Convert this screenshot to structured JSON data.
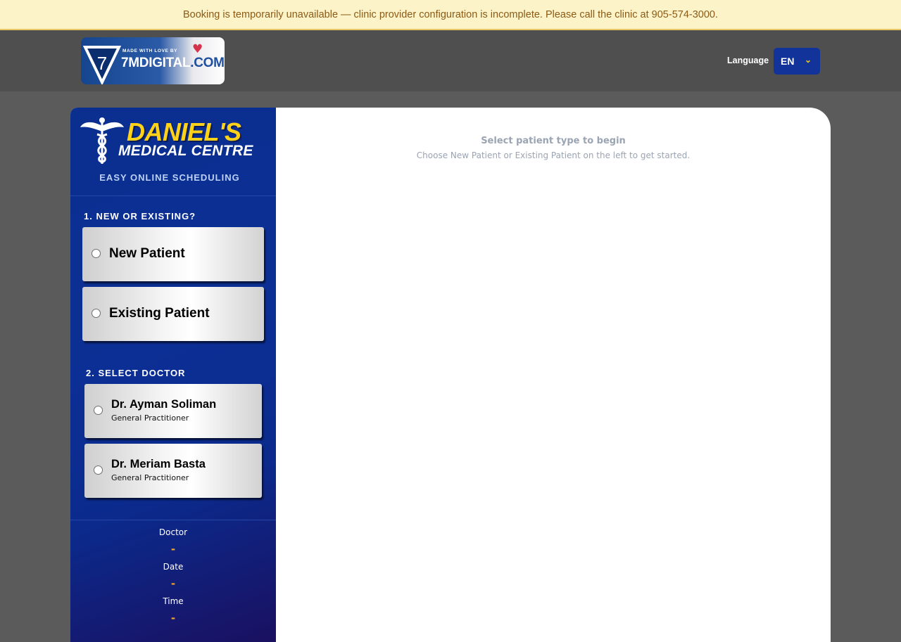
{
  "banner": {
    "text": "Booking is temporarily unavailable — clinic provider configuration is incomplete. Please call the clinic at 905-574-3000."
  },
  "brand": {
    "made_with": "MADE WITH LOVE BY",
    "name_main": "7MDIGITAL",
    "name_suffix": ".COM",
    "badge_number": "7"
  },
  "language": {
    "label": "Language",
    "selected": "EN"
  },
  "clinic": {
    "name_line1": "DANIEL'S",
    "name_line2": "MEDICAL CENTRE",
    "tagline": "EASY ONLINE SCHEDULING"
  },
  "steps": {
    "patient": {
      "label": "1. NEW OR EXISTING?",
      "options": [
        {
          "label": "New Patient"
        },
        {
          "label": "Existing Patient"
        }
      ]
    },
    "doctor": {
      "label": "2. SELECT DOCTOR",
      "options": [
        {
          "name": "Dr. Ayman Soliman",
          "specialty": "General Practitioner"
        },
        {
          "name": "Dr. Meriam Basta",
          "specialty": "General Practitioner"
        }
      ]
    }
  },
  "summary": {
    "doctor_label": "Doctor",
    "doctor_value": "-",
    "date_label": "Date",
    "date_value": "-",
    "time_label": "Time",
    "time_value": "-"
  },
  "main": {
    "title": "Select patient type to begin",
    "subtitle": "Choose New Patient or Existing Patient on the left to get started."
  },
  "colors": {
    "accent_yellow": "#ffd21a",
    "sidebar_blue": "#0c2f95",
    "summary_value": "#f5a623",
    "banner_bg": "#fdf3c8"
  }
}
